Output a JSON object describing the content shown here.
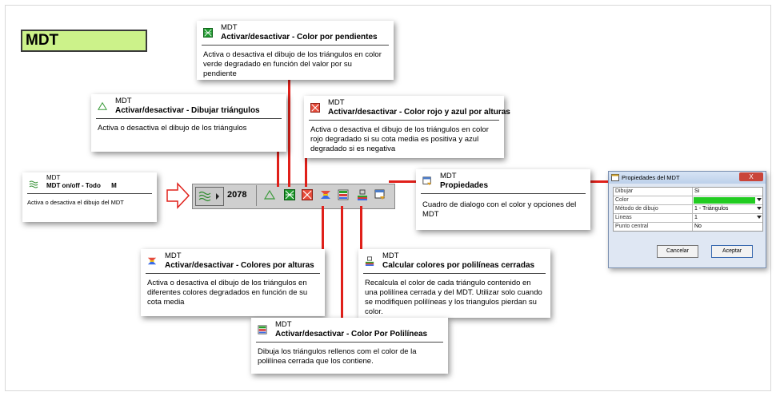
{
  "title": "MDT",
  "toolbar": {
    "count": "2078"
  },
  "arrow": {
    "color": "#e0201a"
  },
  "tooltips": {
    "todo": {
      "app": "MDT",
      "title": "MDT on/off - Todo",
      "shortcut": "M",
      "body": "Activa o desactiva el dibujo del MDT"
    },
    "pendientes": {
      "app": "MDT",
      "title": "Activar/desactivar - Color por pendientes",
      "body": "Activa o desactiva el dibujo de los triángulos en color verde degradado en función del valor por su pendiente"
    },
    "triangulos": {
      "app": "MDT",
      "title": "Activar/desactivar - Dibujar triángulos",
      "body": "Activa o desactiva el dibujo de los triángulos"
    },
    "alturas_rb": {
      "app": "MDT",
      "title": "Activar/desactivar - Color rojo y azul por alturas",
      "body": "Activa o desactiva el dibujo de los triángulos en color rojo degradado si su cota media es positiva y azul degradado si es negativa"
    },
    "propiedades": {
      "app": "MDT",
      "title": "Propiedades",
      "body": "Cuadro de dialogo con el color y opciones del MDT"
    },
    "alturas": {
      "app": "MDT",
      "title": "Activar/desactivar - Colores por alturas",
      "body": "Activa o desactiva el dibujo de los triángulos en diferentes colores degradados en función de su cota media"
    },
    "calcular": {
      "app": "MDT",
      "title": "Calcular colores por polilíneas cerradas",
      "body": "Recalcula el color de cada triángulo contenido en una polilínea cerrada y del MDT. Utilizar solo cuando se modifiquen polilíneas y los triangulos pierdan su color."
    },
    "polilineas": {
      "app": "MDT",
      "title": "Activar/desactivar - Color Por Polilíneas",
      "body": "Dibuja los triángulos rellenos com el color de la polilínea cerrada que los contiene."
    }
  },
  "dialog": {
    "title": "Propiedades del MDT",
    "close": "X",
    "rows": [
      {
        "key": "Dibujar",
        "value": "Si"
      },
      {
        "key": "Color",
        "value": ""
      },
      {
        "key": "Método de dibujo",
        "value": "1 - Triángulos"
      },
      {
        "key": "Lineas",
        "value": "1"
      },
      {
        "key": "Punto central",
        "value": "No"
      }
    ],
    "cancel": "Cancelar",
    "accept": "Aceptar",
    "color_swatch": "#22cc22"
  }
}
